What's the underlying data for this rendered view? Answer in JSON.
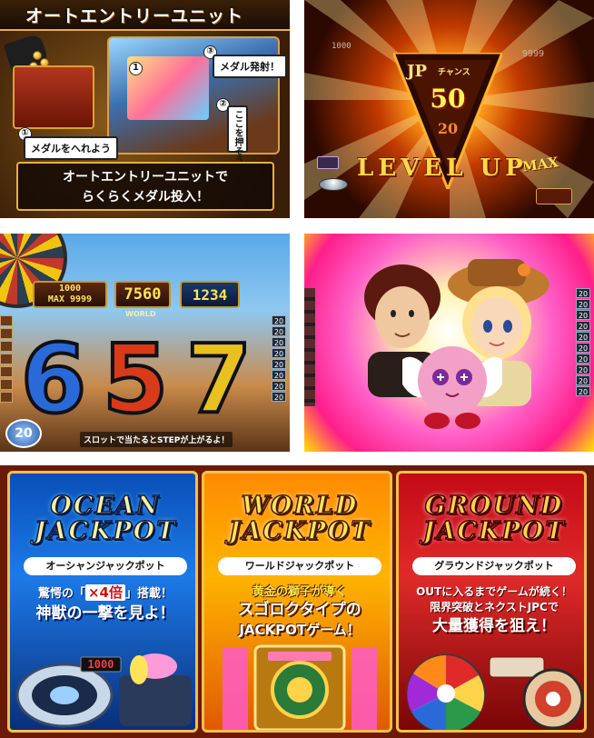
{
  "auto_entry_panel": {
    "title": "オートエントリーユニット",
    "callout_insert": "メダルをへれよう",
    "callout_press": "ここを押そう",
    "callout_fire": "メダル発射！",
    "step_1": "①",
    "step_2": "②",
    "step_3": "③",
    "machine_badge": "1",
    "caption_line1": "オートエントリーユニットで",
    "caption_line2": "らくらくメダル投入！"
  },
  "level_up_panel": {
    "jp_label": "JP",
    "chance_label": "チャンス",
    "jp_value": "50",
    "jp_next": "20",
    "level_up_text": "LEVEL UP",
    "max_text": "MAX",
    "top_left_value": "1000",
    "top_right_value": "9999"
  },
  "slot_panel": {
    "counter_left": "1000",
    "counter_left_max": "MAX 9999",
    "counter_center": "7560",
    "counter_center_label": "WORLD",
    "counter_right": "1234",
    "reel_1": "6",
    "reel_2": "5",
    "reel_3": "7",
    "step_counter": "20",
    "hint": "スロットで当たるとSTEPが上がるよ！",
    "side_values": [
      "20",
      "20",
      "20",
      "20",
      "20",
      "20",
      "20",
      "20"
    ]
  },
  "character_panel": {
    "side_values": [
      "20",
      "20",
      "20",
      "20",
      "20",
      "20",
      "20",
      "20",
      "20",
      "20"
    ]
  },
  "jackpots": [
    {
      "logo_line1": "OCEAN",
      "logo_line2": "JACKPOT",
      "subtitle": "オーシャンジャックポット",
      "desc_pre": "驚愕の「",
      "desc_mult": "×4倍",
      "desc_post": "」搭載！",
      "desc_line2": "神獣の一撃を見よ！",
      "display_value": "1000"
    },
    {
      "logo_line1": "WORLD",
      "logo_line2": "JACKPOT",
      "subtitle": "ワールドジャックポット",
      "desc_line1": "黄金の獅子が導く",
      "desc_line2": "スゴロクタイプの",
      "desc_line3": "JACKPOTゲーム！"
    },
    {
      "logo_line1": "GROUND",
      "logo_line2": "JACKPOT",
      "subtitle": "グラウンドジャックポット",
      "desc_line1": "OUTに入るまでゲームが続く！",
      "desc_line2": "限界突破とネクストJPCで",
      "desc_line3": "大量獲得を狙え！"
    }
  ],
  "colors": {
    "ocean": "#1c7ae8",
    "world": "#ffb400",
    "ground": "#e02a2a",
    "frame_gold": "#f3c04a"
  }
}
